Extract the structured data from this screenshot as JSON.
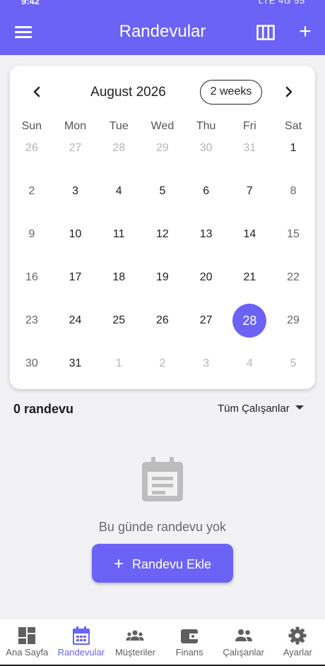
{
  "status_bar": {
    "time": "9:42",
    "indicators": "LTE 4G 55"
  },
  "app_bar": {
    "title": "Randevular",
    "menu_icon": "menu-icon",
    "view_icon": "view-column-icon",
    "add_icon": "add-icon",
    "add_symbol": "+"
  },
  "calendar": {
    "month_label": "August 2026",
    "format_button": "2 weeks",
    "weekdays": [
      "Sun",
      "Mon",
      "Tue",
      "Wed",
      "Thu",
      "Fri",
      "Sat"
    ],
    "weeks": [
      [
        "26",
        "27",
        "28",
        "29",
        "30",
        "31",
        "1"
      ],
      [
        "2",
        "3",
        "4",
        "5",
        "6",
        "7",
        "8"
      ],
      [
        "9",
        "10",
        "11",
        "12",
        "13",
        "14",
        "15"
      ],
      [
        "16",
        "17",
        "18",
        "19",
        "20",
        "21",
        "22"
      ],
      [
        "23",
        "24",
        "25",
        "26",
        "27",
        "28",
        "29"
      ],
      [
        "30",
        "31",
        "1",
        "2",
        "3",
        "4",
        "5"
      ]
    ],
    "selected_day": "28",
    "accent_color": "#6b63f5"
  },
  "appointments": {
    "count_label": "0 randevu",
    "filter_label": "Tüm Çalışanlar",
    "empty_text": "Bu günde randevu yok",
    "add_button": "Randevu Ekle",
    "add_symbol": "+"
  },
  "bottom_nav": {
    "items": [
      {
        "label": "Ana Sayfa",
        "icon": "dashboard-icon"
      },
      {
        "label": "Randevular",
        "icon": "calendar-icon",
        "active": true
      },
      {
        "label": "Müşteriler",
        "icon": "groups-icon"
      },
      {
        "label": "Finans",
        "icon": "wallet-icon"
      },
      {
        "label": "Çalışanlar",
        "icon": "people-icon"
      },
      {
        "label": "Ayarlar",
        "icon": "settings-icon"
      }
    ]
  }
}
